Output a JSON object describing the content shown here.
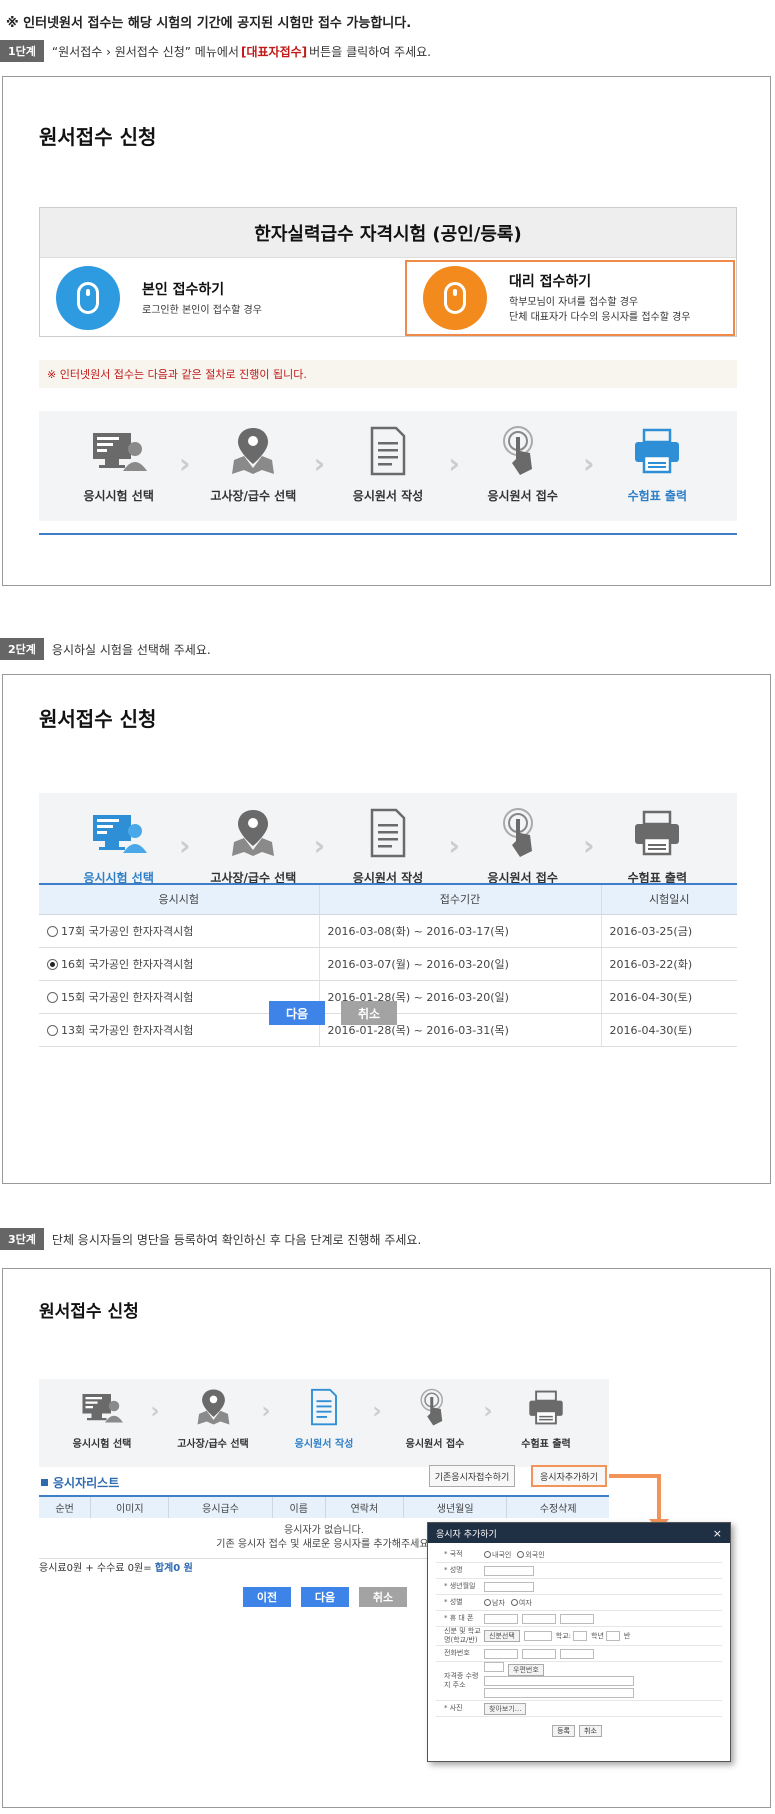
{
  "notice": "※ 인터넷원서 접수는 해당 시험의 기간에 공지된 시험만 접수 가능합니다.",
  "steps": [
    {
      "badge": "1단계",
      "pre": "“원서접수 › 원서접수 신청” 메뉴에서 ",
      "highlight": "[대표자접수]",
      "post": " 버튼을 클릭하여 주세요."
    },
    {
      "badge": "2단계",
      "text": "응시하실 시험을 선택해 주세요."
    },
    {
      "badge": "3단계",
      "text": "단체 응시자들의 명단을 등록하여 확인하신 후 다음 단계로 진행해 주세요."
    }
  ],
  "panel_title": "원서접수 신청",
  "exam_box": {
    "title": "한자실력급수 자격시험 (공인/등록)",
    "self": {
      "title": "본인 접수하기",
      "desc": "로그인한 본인이 접수할 경우"
    },
    "proxy": {
      "title": "대리 접수하기",
      "desc1": "학부모님이 자녀를 접수할 경우",
      "desc2": "단체 대표자가 다수의 응시자를 접수할 경우"
    }
  },
  "process_note": "※ 인터넷원서 접수는 다음과 같은 절차로 진행이 됩니다.",
  "flow_labels": [
    "응시시험 선택",
    "고사장/급수 선택",
    "응시원서 작성",
    "응시원서 접수",
    "수험표 출력"
  ],
  "exam_table": {
    "headers": [
      "응시시험",
      "접수기간",
      "시험일시"
    ],
    "rows": [
      {
        "name": "17회  국가공인 한자자격시험",
        "period": "2016-03-08(화) ~ 2016-03-17(목)",
        "date": "2016-03-25(금)"
      },
      {
        "name": "16회  국가공인 한자자격시험",
        "period": "2016-03-07(월) ~ 2016-03-20(일)",
        "date": "2016-03-22(화)"
      },
      {
        "name": "15회  국가공인 한자자격시험",
        "period": "2016-01-28(목) ~ 2016-03-20(일)",
        "date": "2016-04-30(토)"
      },
      {
        "name": "13회  국가공인 한자자격시험",
        "period": "2016-01-28(목) ~ 2016-03-31(목)",
        "date": "2016-04-30(토)"
      }
    ],
    "selected_index": 1
  },
  "buttons": {
    "next": "다음",
    "cancel": "취소",
    "prev": "이전"
  },
  "list": {
    "title": "응시자리스트",
    "existing_btn": "기존응시자접수하기",
    "add_btn": "응시자추가하기",
    "headers": [
      "순번",
      "이미지",
      "응시급수",
      "이름",
      "연락처",
      "생년월일",
      "수정삭제"
    ],
    "empty1": "응시자가 없습니다.",
    "empty2": "기존 응시자 접수 및 새로운 응시자를 추가해주세요.",
    "fee_pre": "응시료0원 + 수수료 0원= ",
    "fee_sum": "합계0 원"
  },
  "popup": {
    "title": "응시자 추가하기",
    "close": "×",
    "rows": [
      {
        "label": "* 국적",
        "type": "radio",
        "options": [
          "내국인",
          "외국인"
        ]
      },
      {
        "label": "* 성명",
        "type": "box"
      },
      {
        "label": "* 생년월일",
        "type": "box"
      },
      {
        "label": "* 성별",
        "type": "radio",
        "options": [
          "남자",
          "여자"
        ]
      },
      {
        "label": "* 휴 대 폰",
        "type": "phone"
      },
      {
        "label": "신분 및 학교명(학교/반)",
        "type": "school",
        "select": "신분선택",
        "school": "학교:",
        "grade": "학년",
        "class": "반"
      },
      {
        "label": "전화번호",
        "type": "phone"
      },
      {
        "label": "자격증 수령지 주소",
        "type": "address",
        "btn": "우편번호"
      },
      {
        "label": "* 사진",
        "type": "photo",
        "btn": "찾아보기..."
      }
    ],
    "register": "등록",
    "cancel": "취소"
  },
  "colors": {
    "accent_blue": "#3d83e8",
    "highlight_orange": "#f29359",
    "red": "#c01a1a"
  }
}
